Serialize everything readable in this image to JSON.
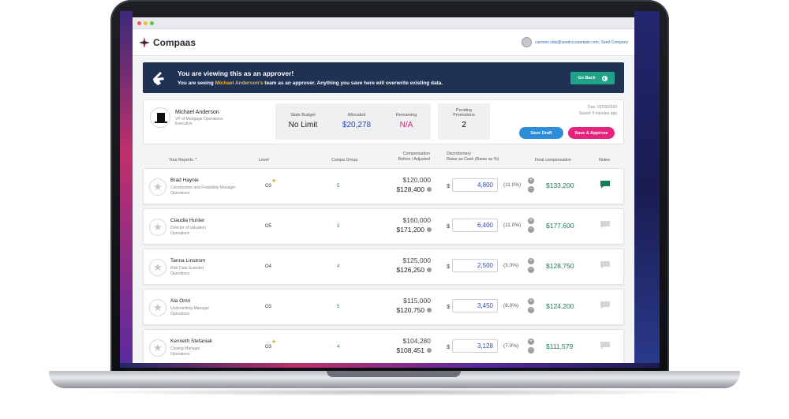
{
  "app": {
    "name": "Compaas"
  },
  "colors": {
    "accent": "#1f3253",
    "approve": "#e6247f",
    "draft": "#2d8ed7",
    "success": "#1fa389",
    "final": "#1a7a5e",
    "raise": "#2a4bb8"
  },
  "user": {
    "email_company": "carmelo.vida@seedco.example.com, Seed Company"
  },
  "banner": {
    "title": "You are viewing this as an approver!",
    "sub_prefix": "You are seeing ",
    "sub_highlight": "Michael Anderson's",
    "sub_suffix": " team as an approver. Anything you save here will overwrite existing data.",
    "go_back": "Go Back"
  },
  "manager": {
    "name": "Michael Anderson",
    "title": "VP of Mortgage Operations",
    "level": "Executive"
  },
  "budget": {
    "slate_label": "Slate Budget",
    "slate_value": "No Limit",
    "allocated_label": "Allocated",
    "allocated_value": "$20,278",
    "remaining_label": "Remaining",
    "remaining_value": "N/A"
  },
  "pending": {
    "label_line1": "Pending",
    "label_line2": "Promotions",
    "value": "2"
  },
  "due": {
    "due": "Due: 02/29/2020",
    "saved": "Saved: 5 minutes ago"
  },
  "actions": {
    "save_draft": "Save Draft",
    "save_approve": "Save & Approve"
  },
  "columns": {
    "reports": "Your Reports ⌃",
    "level": "Level",
    "compa": "Compa Group",
    "comp_line1": "Compensation",
    "comp_line2": "Before / Adjusted",
    "disc_line1": "Discretionary",
    "disc_line2": "Raise as Cash (Raise as %)",
    "final": "Final compensation",
    "notes": "Notes"
  },
  "rows": [
    {
      "name": "Brad Haynie",
      "title": "Construction and Feasibility Manager",
      "dept": "Operations",
      "level": "O3",
      "promo": true,
      "compa": "5",
      "before": "$120,000",
      "adjusted": "$128,400",
      "raise": "4,800",
      "pct": "(11.0%)",
      "final": "$133,200",
      "has_note": true
    },
    {
      "name": "Claudia Hunter",
      "title": "Director of Valuation",
      "dept": "Operations",
      "level": "O5",
      "promo": false,
      "compa": "3",
      "before": "$160,000",
      "adjusted": "$171,200",
      "raise": "6,400",
      "pct": "(11.0%)",
      "final": "$177,600",
      "has_note": false
    },
    {
      "name": "Tanna Linstrom",
      "title": "Risk Data Scientist",
      "dept": "Operations",
      "level": "O4",
      "promo": false,
      "compa": "4",
      "before": "$125,000",
      "adjusted": "$126,250",
      "raise": "2,500",
      "pct": "(3.0%)",
      "final": "$128,750",
      "has_note": false
    },
    {
      "name": "Ala Omri",
      "title": "Underwriting Manager",
      "dept": "Operations",
      "level": "O3",
      "promo": false,
      "compa": "5",
      "before": "$115,000",
      "adjusted": "$120,750",
      "raise": "3,450",
      "pct": "(8.0%)",
      "final": "$124,200",
      "has_note": false
    },
    {
      "name": "Kenneth Stefaniak",
      "title": "Closing Manager",
      "dept": "Operations",
      "level": "O3",
      "promo": true,
      "compa": "4",
      "before": "$104,280",
      "adjusted": "$108,451",
      "raise": "3,128",
      "pct": "(7.0%)",
      "final": "$111,579",
      "has_note": false
    }
  ],
  "row_symbols": {
    "currency": "$",
    "plus": "+",
    "minus": "−",
    "star": "★"
  }
}
